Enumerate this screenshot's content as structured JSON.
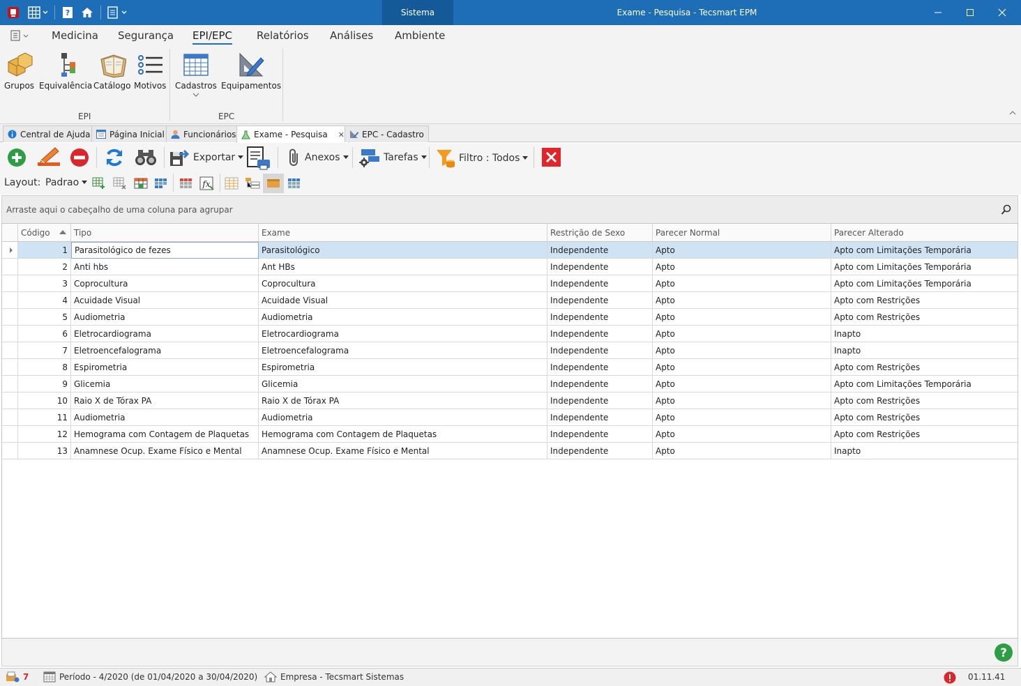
{
  "titlebar": {
    "center_tab": "Sistema",
    "window_title": "Exame - Pesquisa - Tecsmart EPM"
  },
  "ribbon": {
    "tabs": [
      "Medicina",
      "Segurança",
      "EPI/EPC",
      "Relatórios",
      "Análises",
      "Ambiente"
    ],
    "active_tab": "EPI/EPC",
    "epi_buttons": [
      "Grupos",
      "Equivalência",
      "Catálogo",
      "Motivos"
    ],
    "epc_buttons": [
      "Cadastros",
      "Equipamentos"
    ],
    "group_epi": "EPI",
    "group_epc": "EPC"
  },
  "doc_tabs": [
    "Central de Ajuda",
    "Página Inicial",
    "Funcionários",
    "Exame - Pesquisa",
    "EPC - Cadastro"
  ],
  "active_doc_tab": "Exame - Pesquisa",
  "toolbar": {
    "export_label": "Exportar",
    "attachments_label": "Anexos",
    "tasks_label": "Tarefas",
    "filter_label": "Filtro : Todos",
    "layout_label": "Layout:",
    "layout_value": "Padrao"
  },
  "group_panel_text": "Arraste aqui o cabeçalho de uma coluna para agrupar",
  "grid": {
    "columns": [
      "Código",
      "Tipo",
      "Exame",
      "Restrição de Sexo",
      "Parecer Normal",
      "Parecer Alterado"
    ],
    "sort_column": "Código",
    "rows": [
      [
        "1",
        "Parasitológico de fezes",
        "Parasitológico",
        "Independente",
        "Apto",
        "Apto com Limitações Temporária"
      ],
      [
        "2",
        "Anti hbs",
        "Ant HBs",
        "Independente",
        "Apto",
        "Apto com Limitações Temporária"
      ],
      [
        "3",
        "Coprocultura",
        "Coprocultura",
        "Independente",
        "Apto",
        "Apto com Limitações Temporária"
      ],
      [
        "4",
        "Acuidade Visual",
        "Acuidade Visual",
        "Independente",
        "Apto",
        "Apto com Restrições"
      ],
      [
        "5",
        "Audiometria",
        "Audiometria",
        "Independente",
        "Apto",
        "Apto com Restrições"
      ],
      [
        "6",
        "Eletrocardiograma",
        "Eletrocardiograma",
        "Independente",
        "Apto",
        "Inapto"
      ],
      [
        "7",
        "Eletroencefalograma",
        "Eletroencefalograma",
        "Independente",
        "Apto",
        "Inapto"
      ],
      [
        "8",
        "Espirometria",
        "Espirometria",
        "Independente",
        "Apto",
        "Apto com Restrições"
      ],
      [
        "9",
        "Glicemia",
        "Glicemia",
        "Independente",
        "Apto",
        "Apto com Limitações Temporária"
      ],
      [
        "10",
        "Raio X de Tórax PA",
        "Raio X de Tórax PA",
        "Independente",
        "Apto",
        "Apto com Restrições"
      ],
      [
        "11",
        "Audiometria",
        "Audiometria",
        "Independente",
        "Apto",
        "Apto com Restrições"
      ],
      [
        "12",
        "Hemograma com Contagem de Plaquetas",
        "Hemograma com Contagem de Plaquetas",
        "Independente",
        "Apto",
        "Apto com Restrições"
      ],
      [
        "13",
        "Anamnese Ocup. Exame Físico e Mental",
        "Anamnese Ocup. Exame Físico e Mental",
        "Independente",
        "Apto",
        "Inapto"
      ]
    ]
  },
  "status": {
    "notifications": "7",
    "period": "Período - 4/2020 (de 01/04/2020 a 30/04/2020)",
    "company": "Empresa - Tecsmart Sistemas",
    "version": "01.11.41"
  },
  "colors": {
    "titlebar": "#1d6eb6",
    "selected_row": "#cfe3f5",
    "add": "#2e9e44",
    "delete": "#d9262c",
    "close_red": "#e0252b"
  }
}
